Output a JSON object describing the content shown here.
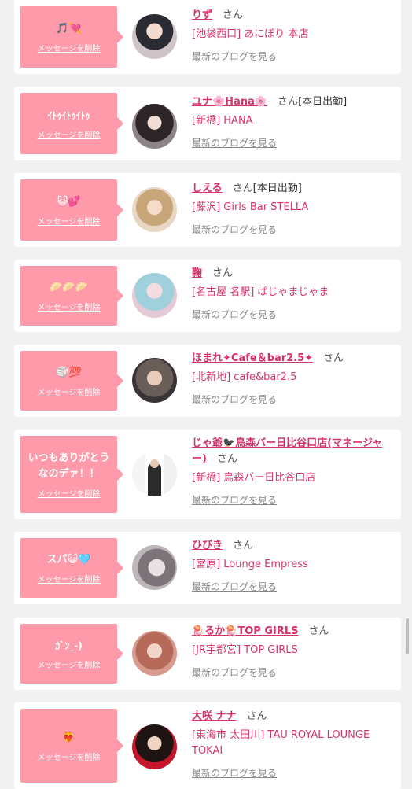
{
  "delete_label": "メッセージを削除",
  "blog_label": "最新のブログを見る",
  "san_label": "さん",
  "cards": [
    {
      "message": "🎵💘",
      "name": "りず",
      "suffix": "",
      "shop": "[池袋西口] あにぽり 本店"
    },
    {
      "message": "ｲﾄｩｲﾄｩｲﾄｩ",
      "name": "ユナ🌸Hana🌸",
      "suffix": "[本日出勤]",
      "shop": "[新橋] HANA"
    },
    {
      "message": "😺💕",
      "name": "しえる",
      "suffix": "[本日出勤]",
      "shop": "[藤沢] Girls Bar STELLA"
    },
    {
      "message": "🥟🥟🥟",
      "name": "鞠",
      "suffix": "",
      "shop": "[名古屋 名駅] ぱじゃまじゃま"
    },
    {
      "message": "🏐💯",
      "name": "ほまれ✦Cafe＆bar2.5✦",
      "suffix": "",
      "shop": "[北新地] cafe&bar2.5"
    },
    {
      "message": "いつもありがとうなのデァ！！",
      "name": "じゃ爺🐦‍⬛鳥森バー日比谷口店(マネージャー)",
      "suffix": "",
      "shop": "[新橋] 鳥森バー日比谷口店"
    },
    {
      "message": "スパ😺🩵",
      "name": "ひびき",
      "suffix": "",
      "shop": "[宮原] Lounge Empress"
    },
    {
      "message": "ｶﾞﾝ_-)",
      "name": "🪼るか🪼TOP GIRLS",
      "suffix": "",
      "shop": "[JR宇都宮] TOP GIRLS"
    },
    {
      "message": "❤️‍🔥",
      "name": "大咲 ナナ",
      "suffix": "",
      "shop": "[東海市 太田川] TAU ROYAL LOUNGE TOKAI"
    }
  ]
}
